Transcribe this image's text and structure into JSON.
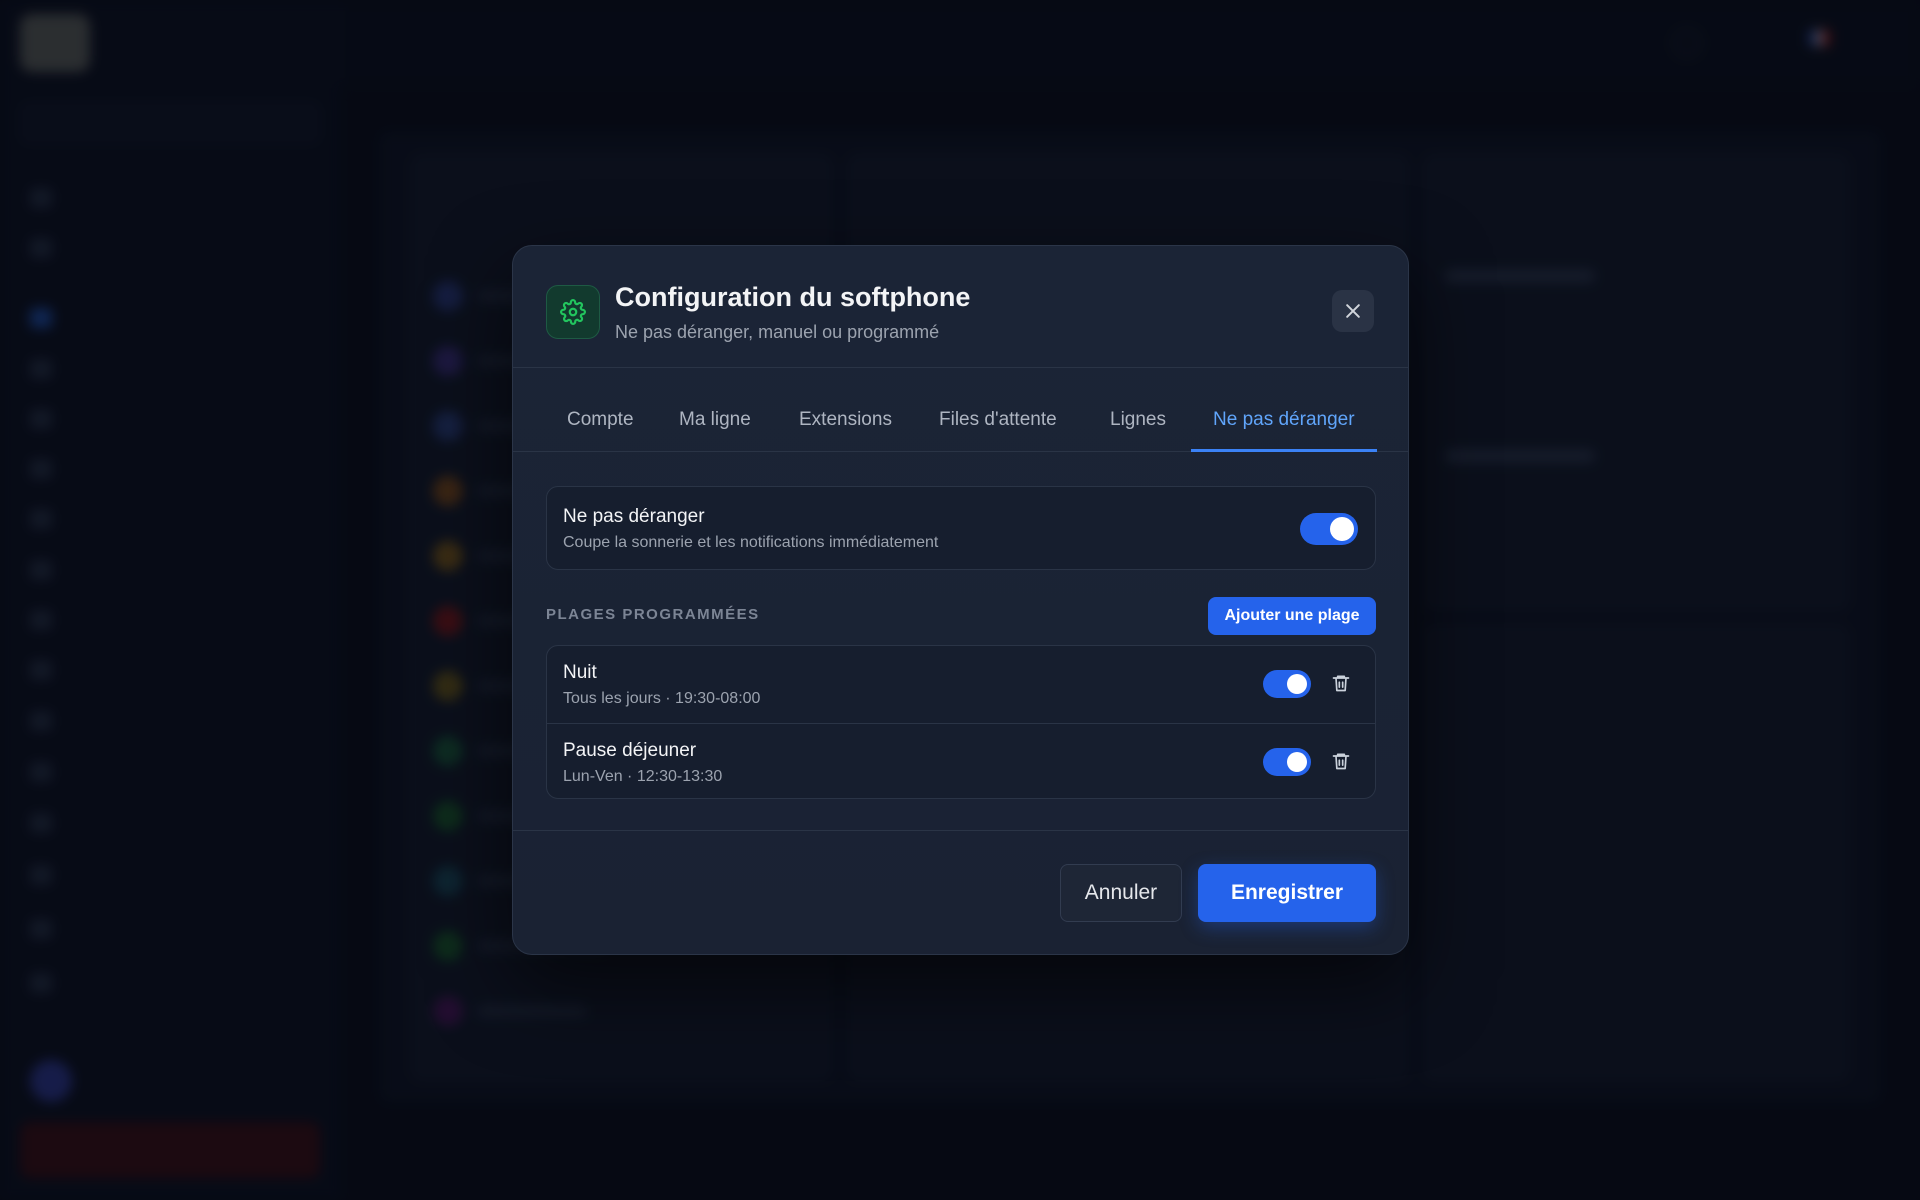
{
  "modal": {
    "title": "Configuration du softphone",
    "subtitle": "Ne pas déranger, manuel ou programmé",
    "icon": "gear-icon",
    "tabs": [
      {
        "label": "Compte"
      },
      {
        "label": "Ma ligne"
      },
      {
        "label": "Extensions"
      },
      {
        "label": "Files d'attente"
      },
      {
        "label": "Lignes"
      },
      {
        "label": "Ne pas déranger",
        "active": true
      }
    ],
    "dnd": {
      "title": "Ne pas déranger",
      "description": "Coupe la sonnerie et les notifications immédiatement",
      "enabled": true
    },
    "schedules": {
      "section_label": "PLAGES PROGRAMMÉES",
      "add_label": "Ajouter une plage",
      "items": [
        {
          "name": "Nuit",
          "time": "Tous les jours · 19:30-08:00",
          "enabled": true
        },
        {
          "name": "Pause déjeuner",
          "time": "Lun-Ven · 12:30-13:30",
          "enabled": true
        }
      ]
    },
    "footer": {
      "cancel_label": "Annuler",
      "save_label": "Enregistrer"
    }
  },
  "colors": {
    "accent": "#2563eb",
    "active_tab": "#60a5fa",
    "icon_green": "#22c55e",
    "modal_bg": "#1b2436"
  }
}
